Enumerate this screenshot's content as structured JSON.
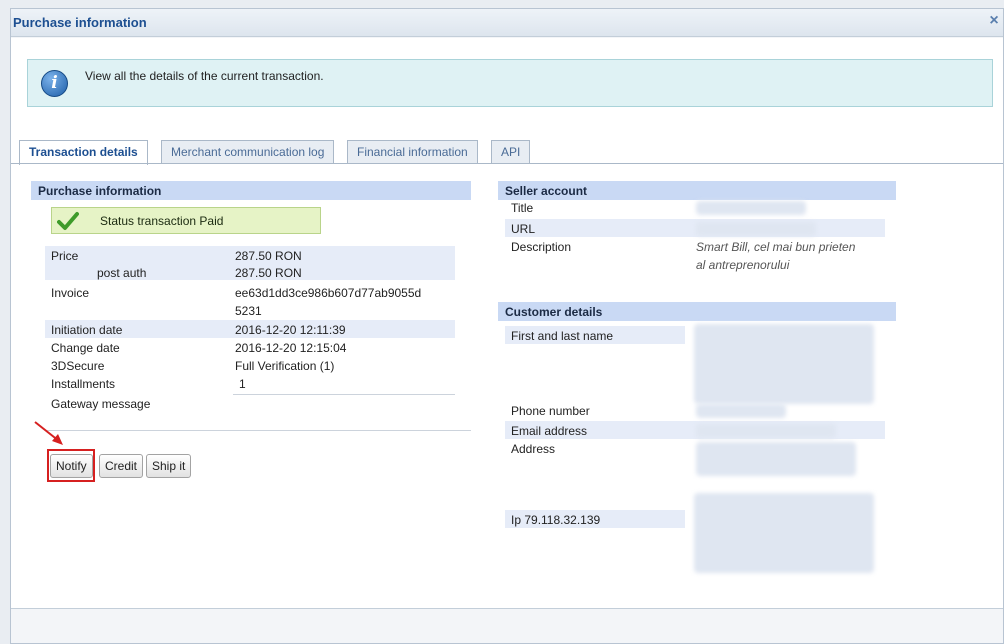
{
  "window": {
    "title": "Purchase information",
    "close_icon": "close-icon"
  },
  "info": {
    "text": "View all the details of the current transaction.",
    "icon": "info-icon"
  },
  "tabs": [
    {
      "label": "Transaction details",
      "active": true
    },
    {
      "label": "Merchant communication log",
      "active": false
    },
    {
      "label": "Financial information",
      "active": false
    },
    {
      "label": "API",
      "active": false
    }
  ],
  "purchase": {
    "heading": "Purchase information",
    "status": "Status transaction Paid",
    "rows": [
      {
        "label": "Price",
        "value": "287.50 RON"
      },
      {
        "label": "post auth",
        "value": "287.50 RON"
      },
      {
        "label": "Invoice",
        "value": "ee63d1dd3ce986b607d77ab9055d",
        "value2": "5231"
      },
      {
        "label": "Initiation date",
        "value": "2016-12-20 12:11:39"
      },
      {
        "label": "Change date",
        "value": "2016-12-20 12:15:04"
      },
      {
        "label": "3DSecure",
        "value": "Full Verification (1)"
      },
      {
        "label": "Installments",
        "value": "1"
      },
      {
        "label": "Gateway message",
        "value": ""
      }
    ],
    "buttons": {
      "notify": "Notify",
      "credit": "Credit",
      "ship": "Ship it"
    }
  },
  "seller": {
    "heading": "Seller account",
    "title_label": "Title",
    "url_label": "URL",
    "description_label": "Description",
    "description_line1": "Smart Bill, cel mai bun prieten",
    "description_line2": "al antreprenorului"
  },
  "customer": {
    "heading": "Customer details",
    "name_label": "First and last name",
    "phone_label": "Phone number",
    "email_label": "Email address",
    "address_label": "Address",
    "ip_label": "Ip 79.118.32.139"
  },
  "colors": {
    "title": "#1d4f91",
    "section_header": "#c9d9f4",
    "status_ok": "#e6f3c6",
    "highlight": "#d62020"
  }
}
